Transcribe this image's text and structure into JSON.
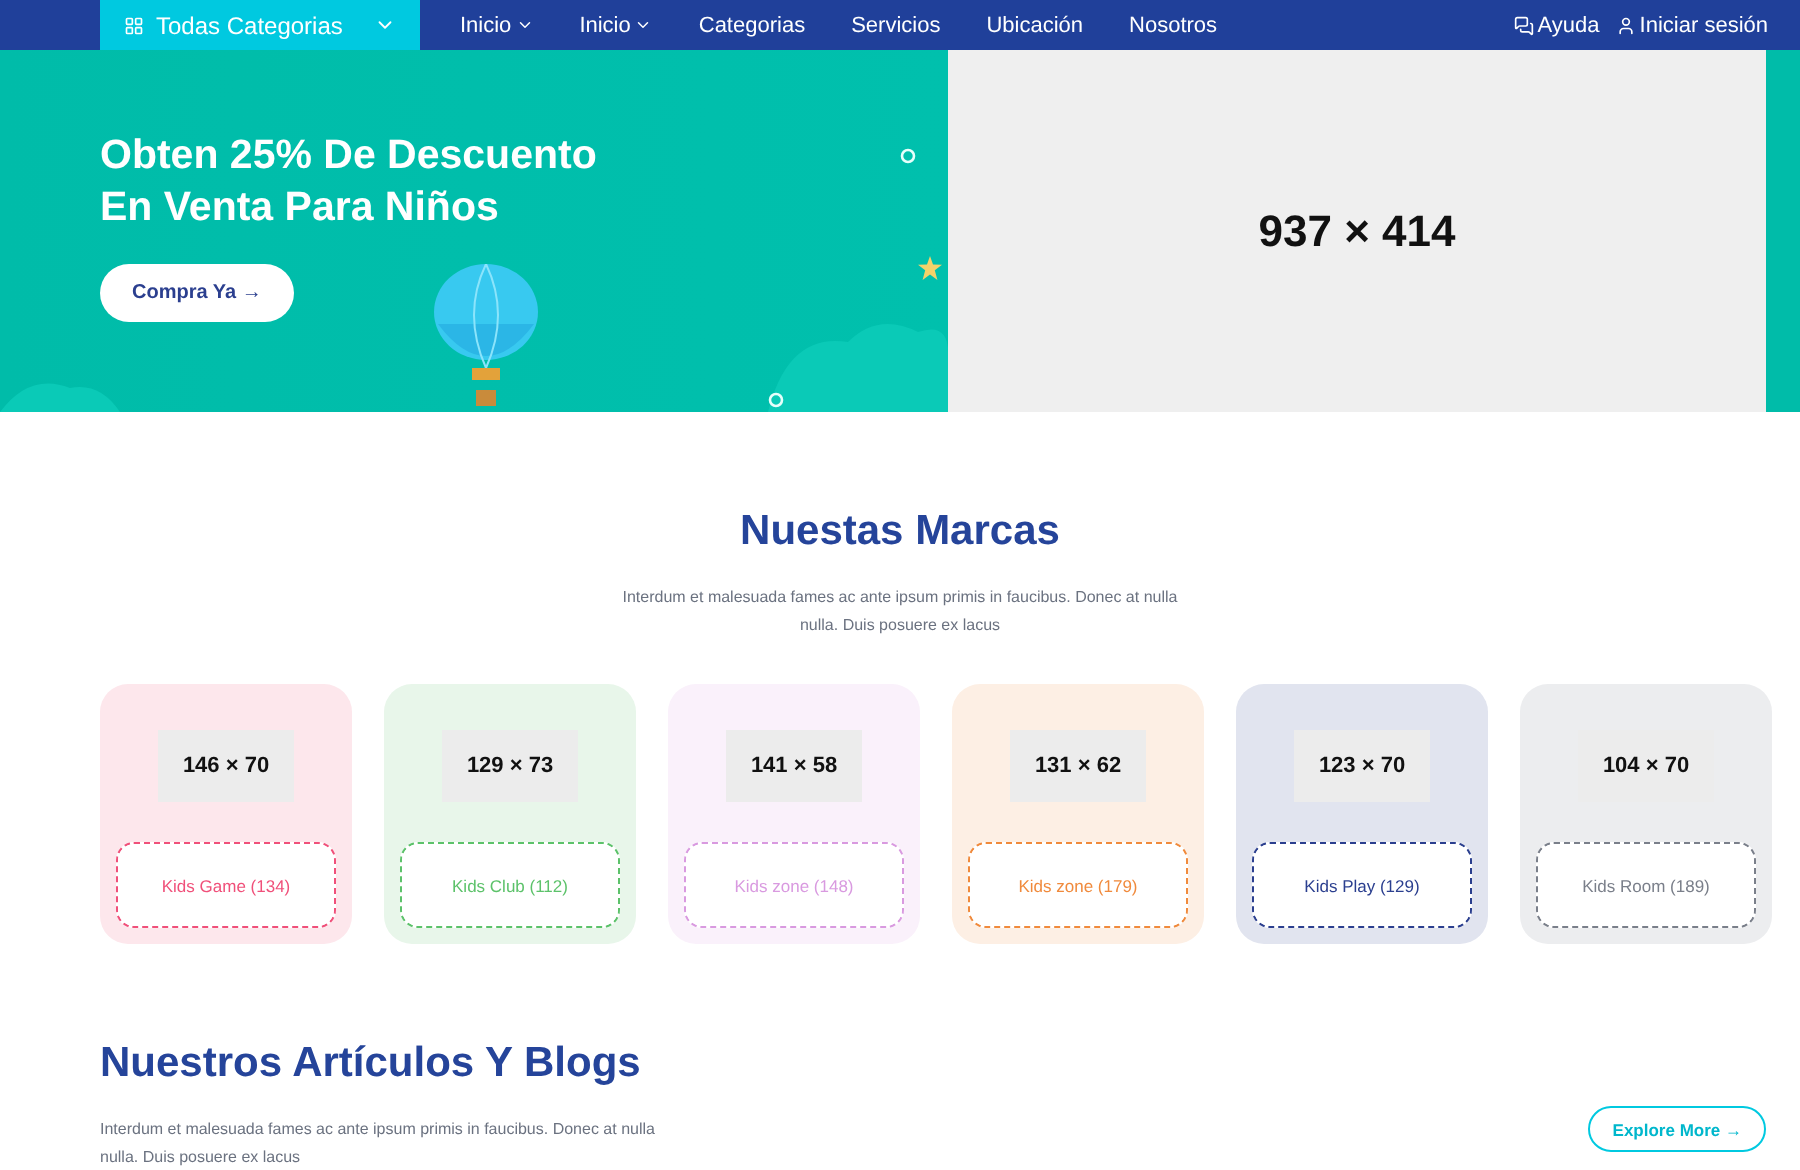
{
  "navbar": {
    "categories_button": "Todas Categorias",
    "items": [
      {
        "label": "Inicio",
        "dropdown": true
      },
      {
        "label": "Inicio",
        "dropdown": true
      },
      {
        "label": "Categorias",
        "dropdown": false
      },
      {
        "label": "Servicios",
        "dropdown": false
      },
      {
        "label": "Ubicación",
        "dropdown": false
      },
      {
        "label": "Nosotros",
        "dropdown": false
      }
    ],
    "help": "Ayuda",
    "login": "Iniciar sesión"
  },
  "hero": {
    "title_lines": [
      "Obten 25% De Descuento",
      "En Venta Para Niños"
    ],
    "button": "Compra Ya →",
    "image_placeholder": "937 × 414"
  },
  "brands": {
    "title": "Nuestas Marcas",
    "subtitle": "Interdum et malesuada fames ac ante ipsum primis in faucibus. Donec at nulla nulla. Duis posuere ex lacus",
    "items": [
      {
        "logo": "146 × 70",
        "label": "Kids Game (134)",
        "color": "#f0507a"
      },
      {
        "logo": "129 × 73",
        "label": "Kids Club (112)",
        "color": "#5cc26a"
      },
      {
        "logo": "141 × 58",
        "label": "Kids zone (148)",
        "color": "#d99ae0"
      },
      {
        "logo": "131 × 62",
        "label": "Kids zone (179)",
        "color": "#f08a3c"
      },
      {
        "logo": "123 × 70",
        "label": "Kids Play (129)",
        "color": "#2b3f8f"
      },
      {
        "logo": "104 × 70",
        "label": "Kids Room (189)",
        "color": "#7a7f8a"
      }
    ]
  },
  "blogs": {
    "title": "Nuestros Artículos Y Blogs",
    "subtitle": "Interdum et malesuada fames ac ante ipsum primis in faucibus. Donec at nulla nulla. Duis posuere ex lacus",
    "button": "Explore More →"
  }
}
